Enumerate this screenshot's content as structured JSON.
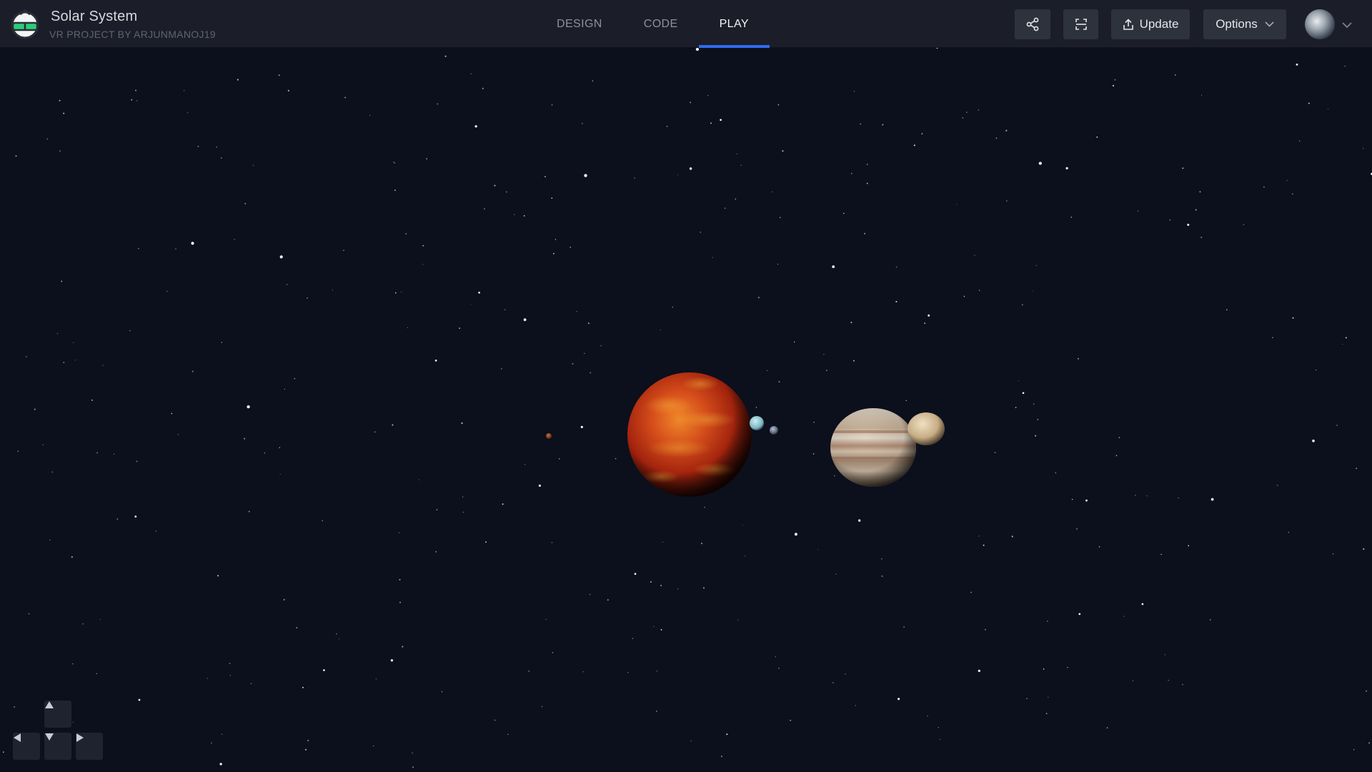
{
  "app": {
    "title": "Solar System",
    "subtitle": "VR PROJECT BY ARJUNMANOJ19"
  },
  "tabs": [
    {
      "label": "DESIGN",
      "active": false
    },
    {
      "label": "CODE",
      "active": false
    },
    {
      "label": "PLAY",
      "active": true
    }
  ],
  "toolbar": {
    "share_icon": "share-icon",
    "fullscreen_icon": "fullscreen-icon",
    "update_label": "Update",
    "update_icon": "upload-icon",
    "options_label": "Options",
    "options_icon": "chevron-down-icon"
  },
  "colors": {
    "background": "#0c0f1c",
    "topbar": "#1b1e29",
    "accent": "#2f6cf0",
    "button": "#2e323d"
  },
  "scene": {
    "bodies": [
      {
        "name": "mars",
        "color": "#a0502c"
      },
      {
        "name": "sun",
        "color": "#d5401a"
      },
      {
        "name": "uranus",
        "color": "#8fc3cf"
      },
      {
        "name": "earth",
        "color": "#6d7a8c"
      },
      {
        "name": "jupiter",
        "color": "#c9b7a0"
      },
      {
        "name": "saturn",
        "color": "#d9c6a3"
      }
    ]
  },
  "controls": {
    "up_icon": "arrow-up-icon",
    "down_icon": "arrow-down-icon",
    "left_icon": "arrow-left-icon",
    "right_icon": "arrow-right-icon"
  }
}
